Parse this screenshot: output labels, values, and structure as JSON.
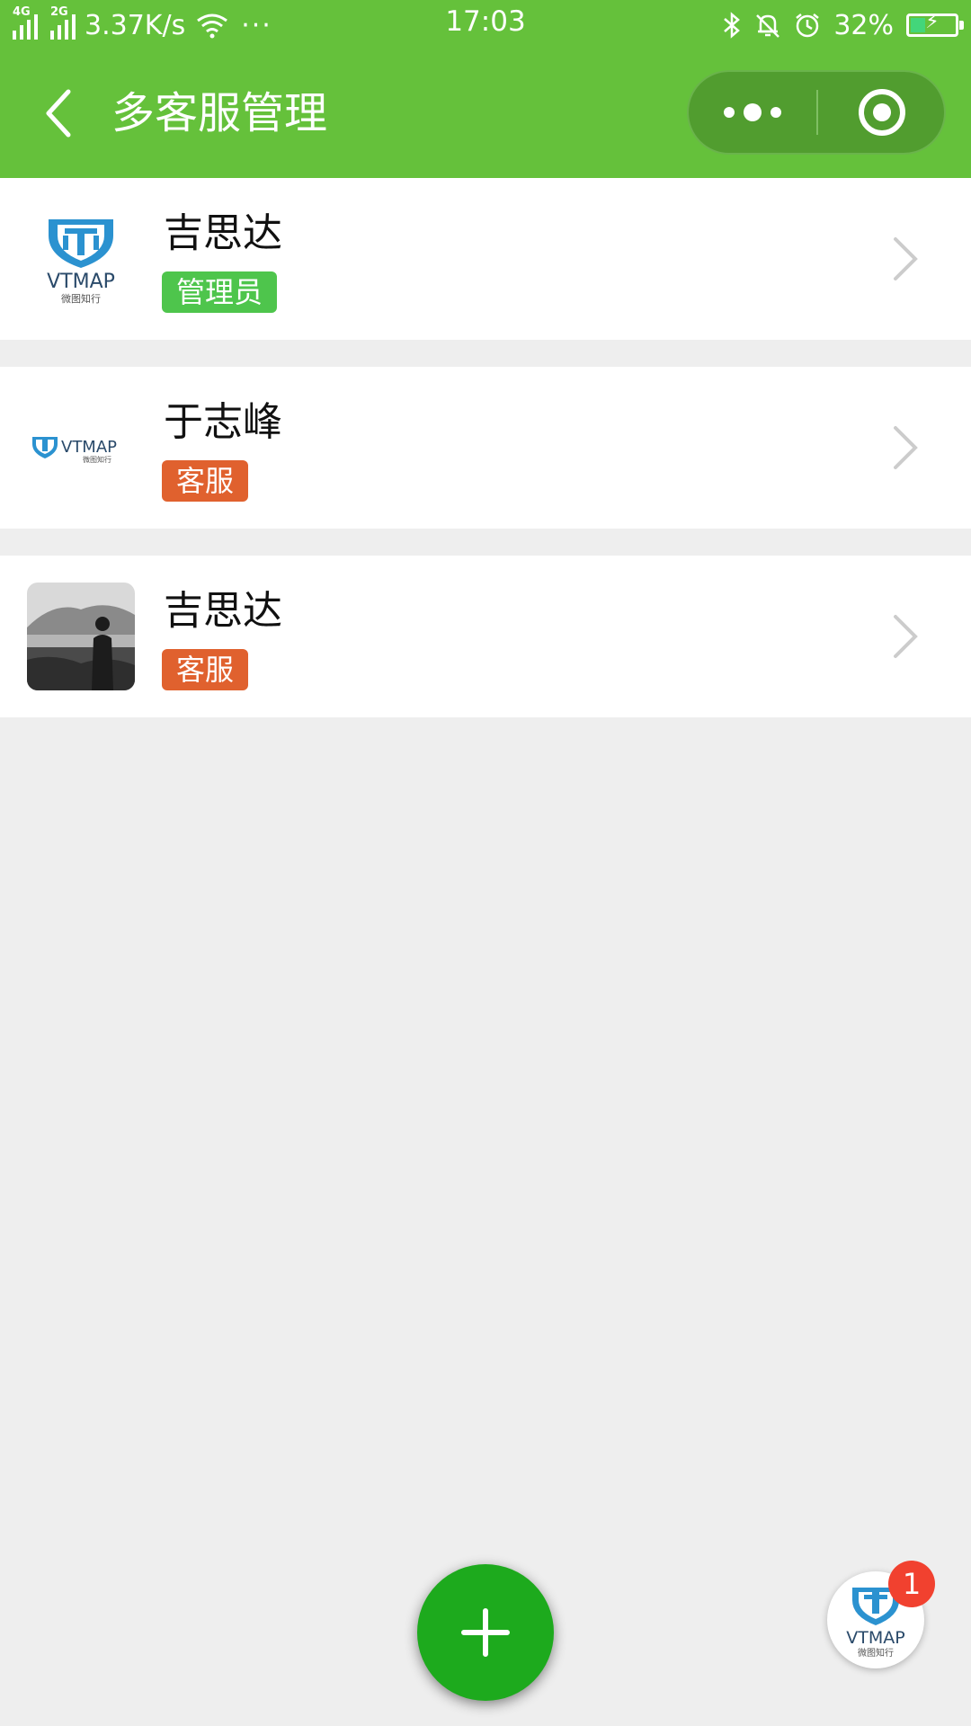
{
  "status_bar": {
    "network1": "4G",
    "network2": "2G",
    "speed": "3.37K/s",
    "more": "···",
    "time": "17:03",
    "battery": "32%"
  },
  "nav": {
    "title": "多客服管理",
    "icons": [
      "back-icon",
      "more-dots-icon",
      "target-icon"
    ]
  },
  "list": {
    "items": [
      {
        "name": "吉思达",
        "tag": "管理员",
        "avatar": "vtmap-logo"
      },
      {
        "name": "于志峰",
        "tag": "客服",
        "avatar": "vtmap-logo-wide"
      },
      {
        "name": "吉思达",
        "tag": "客服",
        "avatar": "landscape-photo"
      }
    ]
  },
  "fab": {
    "icon": "plus-icon"
  },
  "floating": {
    "badge_count": "1"
  },
  "logo": {
    "text": "VTMAP",
    "subtext": "微图知行"
  },
  "colors": {
    "header_green": "#65c13b",
    "admin_tag": "#4ec54c",
    "staff_tag": "#e0612e",
    "fab_green": "#1daa1d",
    "badge_red": "#f1412f",
    "background": "#eeeeee"
  }
}
